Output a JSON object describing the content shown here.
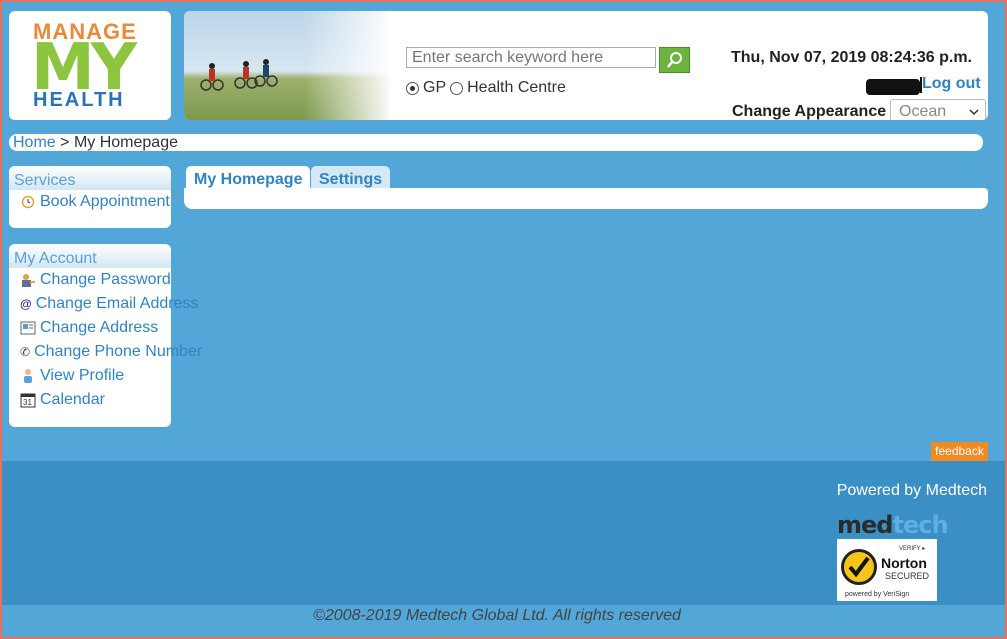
{
  "logo": {
    "top": "MANAGE",
    "middle": "MY",
    "bottom": "HEALTH"
  },
  "search": {
    "placeholder": "Enter search keyword here",
    "options": [
      "GP",
      "Health Centre"
    ],
    "selected": "GP"
  },
  "header": {
    "datetime": "Thu, Nov 07, 2019 08:24:36 p.m.",
    "logout_label": "Log out",
    "change_appearance_label": "Change Appearance",
    "appearance_value": "Ocean"
  },
  "breadcrumb": {
    "home": "Home",
    "separator": ">",
    "current": "My Homepage"
  },
  "services": {
    "title": "Services",
    "items": [
      {
        "label": "Book Appointment",
        "icon": "clock-icon"
      }
    ]
  },
  "account": {
    "title": "My Account",
    "items": [
      {
        "label": "Change Password",
        "icon": "key-user-icon"
      },
      {
        "label": "Change Email Address",
        "icon": "at-sign-icon"
      },
      {
        "label": "Change Address",
        "icon": "address-card-icon"
      },
      {
        "label": "Change Phone Number",
        "icon": "phone-icon"
      },
      {
        "label": "View Profile",
        "icon": "person-icon"
      },
      {
        "label": "Calendar",
        "icon": "calendar-icon"
      }
    ]
  },
  "tabs": [
    {
      "label": "My Homepage",
      "active": true
    },
    {
      "label": "Settings",
      "active": false
    }
  ],
  "feedback_label": "feedback",
  "footer": {
    "powered_by": "Powered by Medtech",
    "medtech_logo": {
      "part1": "med",
      "part2": "tech"
    },
    "norton": {
      "verify": "VERIFY ▸",
      "brand": "Norton",
      "secured": "SECURED",
      "powered": "powered by VeriSign"
    },
    "copyright": "©2008-2019 Medtech Global Ltd. All rights reserved"
  },
  "colors": {
    "background": "#52a7d8",
    "link": "#3183c1",
    "accent_green": "#8cc640",
    "accent_orange": "#e98a3a",
    "footer": "#3a8fc4"
  }
}
